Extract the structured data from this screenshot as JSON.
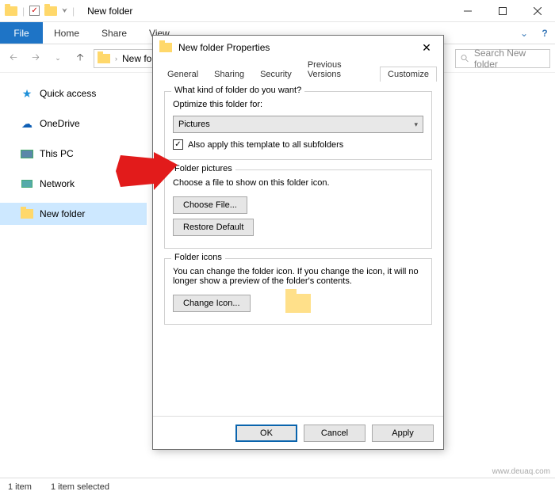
{
  "window": {
    "title": "New folder"
  },
  "ribbon": {
    "file": "File",
    "tabs": [
      "Home",
      "Share",
      "View"
    ]
  },
  "address": {
    "crumb": "New fo",
    "sep": "›"
  },
  "search": {
    "placeholder": "Search New folder"
  },
  "sidebar": {
    "items": [
      {
        "label": "Quick access",
        "icon": "star"
      },
      {
        "label": "OneDrive",
        "icon": "cloud"
      },
      {
        "label": "This PC",
        "icon": "pc"
      },
      {
        "label": "Network",
        "icon": "net"
      },
      {
        "label": "New folder",
        "icon": "folder",
        "selected": true
      }
    ]
  },
  "status": {
    "count": "1 item",
    "selected": "1 item selected",
    "watermark": "www.deuaq.com"
  },
  "dialog": {
    "title": "New folder Properties",
    "tabs": [
      "General",
      "Sharing",
      "Security",
      "Previous Versions",
      "Customize"
    ],
    "active_tab": 4,
    "group1": {
      "legend": "What kind of folder do you want?",
      "optimize_label": "Optimize this folder for:",
      "select_value": "Pictures",
      "checkbox_checked": true,
      "checkbox_label": "Also apply this template to all subfolders"
    },
    "group2": {
      "legend": "Folder pictures",
      "desc": "Choose a file to show on this folder icon.",
      "choose_btn": "Choose File...",
      "restore_btn": "Restore Default"
    },
    "group3": {
      "legend": "Folder icons",
      "desc": "You can change the folder icon. If you change the icon, it will no longer show a preview of the folder's contents.",
      "change_btn": "Change Icon..."
    },
    "buttons": {
      "ok": "OK",
      "cancel": "Cancel",
      "apply": "Apply"
    }
  }
}
